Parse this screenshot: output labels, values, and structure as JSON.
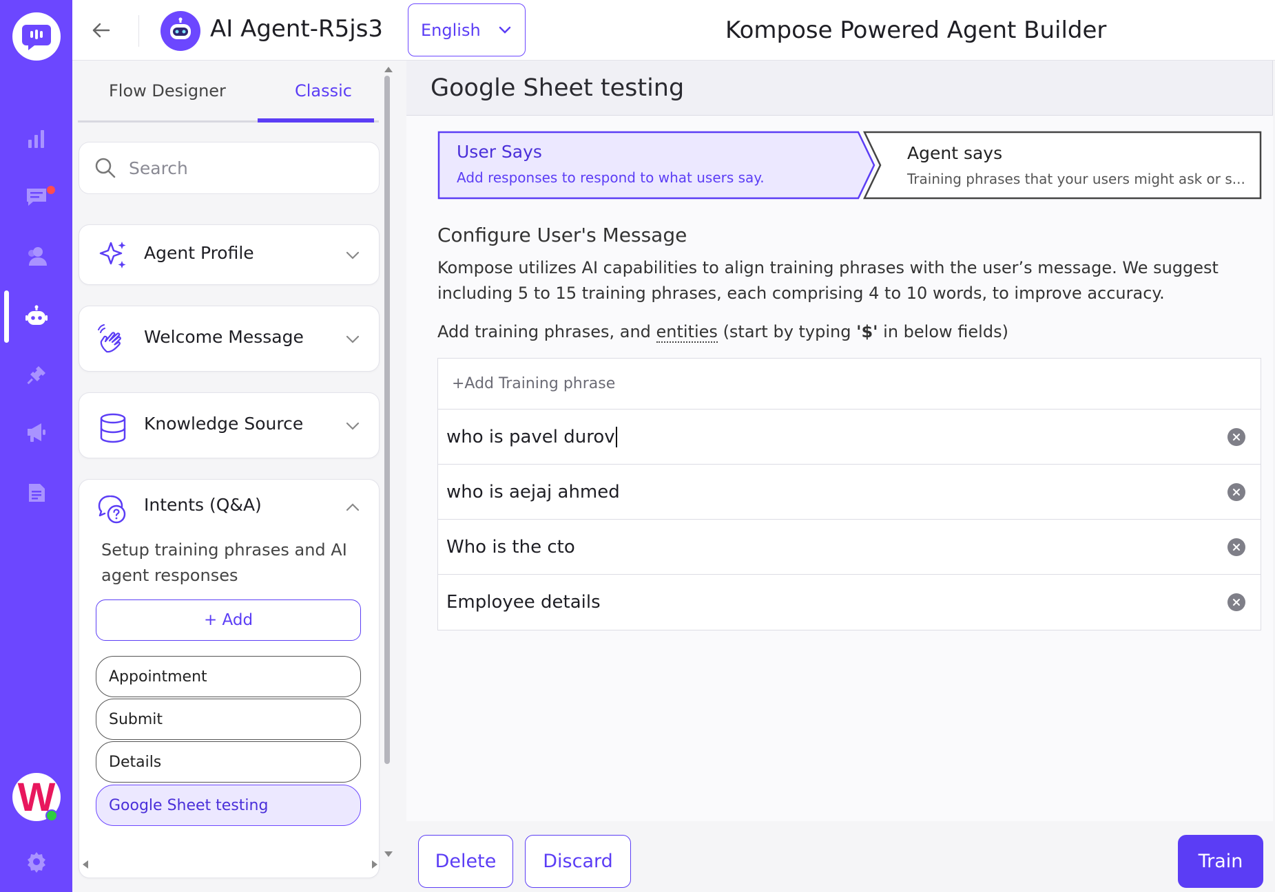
{
  "header": {
    "agent_name": "AI Agent-R5js3",
    "language": "English",
    "builder_title": "Kompose Powered Agent Builder"
  },
  "sidebar": {
    "tabs": [
      {
        "label": "Flow Designer",
        "active": false
      },
      {
        "label": "Classic",
        "active": true
      }
    ],
    "search_placeholder": "Search",
    "sections": {
      "agent_profile": "Agent Profile",
      "welcome_message": "Welcome Message",
      "knowledge_source": "Knowledge Source",
      "intents": "Intents (Q&A)"
    },
    "intents_description": "Setup training phrases and AI agent responses",
    "add_label": "+ Add",
    "intents_list": [
      "Appointment",
      "Submit",
      "Details",
      "Google Sheet testing"
    ],
    "active_intent": "Google Sheet testing"
  },
  "main": {
    "intent_title": "Google Sheet testing",
    "steps": {
      "user_says": {
        "label": "User Says",
        "subtitle": "Add responses to respond to what users say."
      },
      "agent_says": {
        "label": "Agent says",
        "subtitle": "Training phrases that your users might ask or s..."
      }
    },
    "section_title": "Configure User's Message",
    "description": "Kompose utilizes AI capabilities to align training phrases with the user’s message. We suggest including 5 to 15 training phrases, each comprising 4 to 10 words, to improve accuracy.",
    "instruction": {
      "before": "Add training phrases, and ",
      "entities": "entities",
      "middle": " (start by typing ",
      "token": "'$'",
      "after": " in below fields)"
    },
    "add_phrase_placeholder": "+Add Training phrase",
    "phrases": [
      "who is pavel durov",
      "who is aejaj ahmed",
      "Who is the cto",
      "Employee details"
    ]
  },
  "footer": {
    "delete_label": "Delete",
    "discard_label": "Discard",
    "train_label": "Train"
  },
  "colors": {
    "brand": "#6c47ff",
    "accent": "#5b3df5",
    "notification": "#ff4d4f",
    "online": "#2ecc40"
  },
  "icons": {
    "rail": [
      "chat-logo-icon",
      "analytics-icon",
      "conversations-icon",
      "contacts-icon",
      "bot-icon",
      "integrations-icon",
      "campaigns-icon",
      "notes-icon",
      "settings-icon"
    ],
    "user_avatar_letter": "W"
  }
}
